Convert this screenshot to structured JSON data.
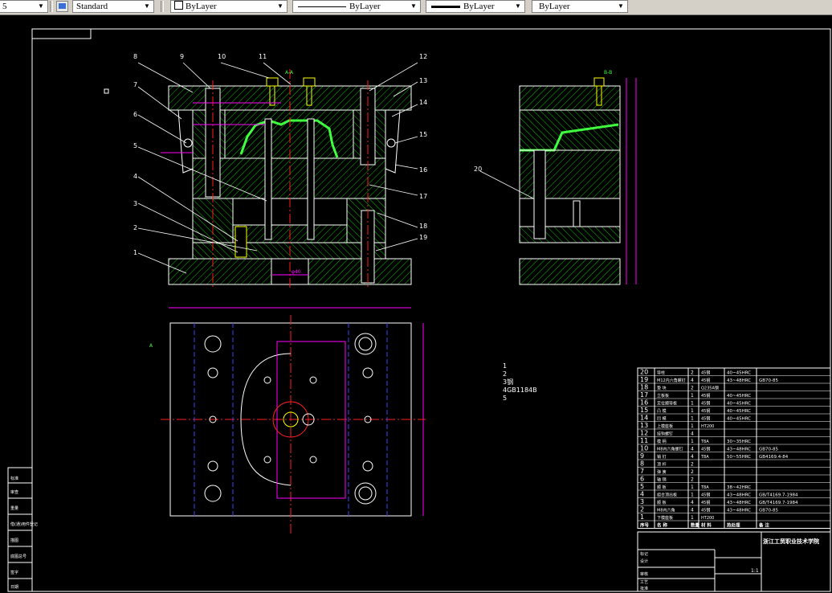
{
  "toolbar": {
    "left_fragment": "5",
    "text_style": "Standard",
    "layer": "ByLayer",
    "linetype": "ByLayer",
    "lineweight": "ByLayer",
    "plotstyle": "ByLayer"
  },
  "drawing": {
    "section_label": "A-A",
    "side_label": "B-B",
    "view_marker_a": "A",
    "callouts": [
      "1",
      "2",
      "3",
      "4",
      "5",
      "6",
      "7",
      "8",
      "9",
      "10",
      "11",
      "12",
      "13",
      "14",
      "15",
      "16",
      "17",
      "18",
      "19",
      "20"
    ],
    "dim_bottom": "φ40",
    "notes": [
      "1",
      "2",
      "3钢",
      "4GB1184B",
      "5"
    ]
  },
  "bom": {
    "rows": [
      {
        "no": "20",
        "name": "导柱",
        "qty": "2",
        "material": "45钢",
        "hardness": "40~45HRC",
        "std": ""
      },
      {
        "no": "19",
        "name": "M12内六角螺钉",
        "qty": "4",
        "material": "45钢",
        "hardness": "43~48HRC",
        "std": "GB70-85"
      },
      {
        "no": "18",
        "name": "垫 块",
        "qty": "2",
        "material": "Q235A钢",
        "hardness": "",
        "std": ""
      },
      {
        "no": "17",
        "name": "立板板",
        "qty": "1",
        "material": "45钢",
        "hardness": "40~45HRC",
        "std": ""
      },
      {
        "no": "16",
        "name": "定位顺导板",
        "qty": "1",
        "material": "45钢",
        "hardness": "40~45HRC",
        "std": ""
      },
      {
        "no": "15",
        "name": "凸 模",
        "qty": "1",
        "material": "45钢",
        "hardness": "40~45HRC",
        "std": ""
      },
      {
        "no": "14",
        "name": "凹 模",
        "qty": "1",
        "material": "45钢",
        "hardness": "40~45HRC",
        "std": ""
      },
      {
        "no": "13",
        "name": "上模座板",
        "qty": "1",
        "material": "HT200",
        "hardness": "",
        "std": ""
      },
      {
        "no": "12",
        "name": "挂钩螺钉",
        "qty": "4",
        "material": "",
        "hardness": "",
        "std": ""
      },
      {
        "no": "11",
        "name": "模 柄",
        "qty": "1",
        "material": "T8A",
        "hardness": "30~35HRC",
        "std": ""
      },
      {
        "no": "10",
        "name": "M8内六角螺钉",
        "qty": "4",
        "material": "45钢",
        "hardness": "43~48HRC",
        "std": "GB70-85"
      },
      {
        "no": "9",
        "name": "销 钉",
        "qty": "4",
        "material": "T8A",
        "hardness": "50~55HRC",
        "std": "GB4169.4-84"
      },
      {
        "no": "8",
        "name": "顶 杆",
        "qty": "2",
        "material": "",
        "hardness": "",
        "std": ""
      },
      {
        "no": "7",
        "name": "弹 簧",
        "qty": "2",
        "material": "",
        "hardness": "",
        "std": ""
      },
      {
        "no": "6",
        "name": "轴 销",
        "qty": "2",
        "material": "",
        "hardness": "",
        "std": ""
      },
      {
        "no": "5",
        "name": "顺 板",
        "qty": "1",
        "material": "T8A",
        "hardness": "38~42HRC",
        "std": ""
      },
      {
        "no": "4",
        "name": "组合顶出板",
        "qty": "1",
        "material": "45钢",
        "hardness": "43~48HRC",
        "std": "GB/T4169.7-1984"
      },
      {
        "no": "3",
        "name": "顺 板",
        "qty": "4",
        "material": "45钢",
        "hardness": "43~48HRC",
        "std": "GB/T4169.7-1984"
      },
      {
        "no": "2",
        "name": "M8内六角",
        "qty": "4",
        "material": "45钢",
        "hardness": "43~48HRC",
        "std": "GB70-85"
      },
      {
        "no": "1",
        "name": "下模座板",
        "qty": "1",
        "material": "HT200",
        "hardness": "",
        "std": ""
      }
    ],
    "header": [
      "序号",
      "名 称",
      "数量",
      "材 料",
      "热处理",
      "备 注"
    ],
    "title": "浙江工贸职业技术学院",
    "scale": "1:1",
    "sheet_labels": [
      "标记",
      "设计",
      "审核",
      "工艺",
      "批准"
    ],
    "left_panel": [
      "标准",
      "审查",
      "重量",
      "借(通)用件登记",
      "描图",
      "底图总号",
      "签字",
      "日期"
    ]
  },
  "colors": {
    "hatch": "#00c000",
    "outline": "#ffffff",
    "center": "#ff2020",
    "dim": "#ff00ff",
    "blue": "#4040ff",
    "yellow": "#ffff00",
    "bright_green": "#40ff40"
  }
}
